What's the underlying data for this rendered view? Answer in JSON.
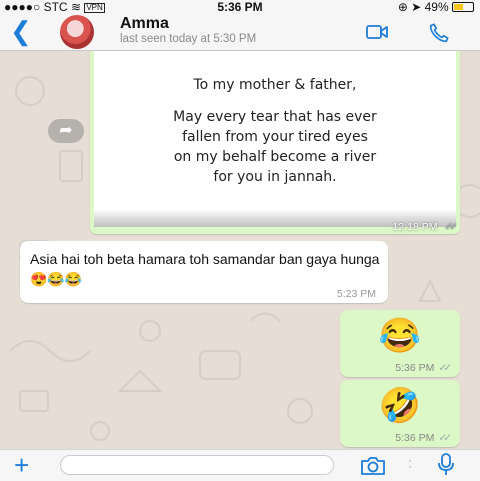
{
  "status_bar": {
    "signal": "●●●●○",
    "carrier": "STC",
    "wifi": "≋",
    "vpn": "VPN",
    "time": "5:36 PM",
    "location_icon": "➤",
    "battery_text": "49%",
    "battery_level": 0.49,
    "battery_color": "#f5c518"
  },
  "header": {
    "back_icon": "back-chevron-icon",
    "contact_name": "Amma",
    "last_seen": "last seen today at 5:30 PM",
    "accent_color": "#1d7dd8"
  },
  "messages": [
    {
      "type": "image",
      "direction": "outgoing",
      "image_text_title": "To my mother & father,",
      "image_text_lines": [
        "May every tear that has ever",
        "fallen from your tired eyes",
        "on my behalf become a river",
        "for you in jannah."
      ],
      "time": "12:18 PM"
    },
    {
      "type": "text",
      "direction": "incoming",
      "text": "Asia hai toh beta  hamara  toh samandar ban gaya hunga  😍😂😂",
      "time": "5:23 PM"
    },
    {
      "type": "emoji",
      "direction": "outgoing",
      "emoji": "😂",
      "time": "5:36 PM"
    },
    {
      "type": "emoji",
      "direction": "outgoing",
      "emoji": "🤣",
      "time": "5:36 PM"
    }
  ],
  "input_bar": {
    "plus_icon": "plus-icon",
    "placeholder": "",
    "camera_icon": "camera-icon",
    "mic_icon": "microphone-icon"
  },
  "colors": {
    "outgoing_bubble": "#dcf8c6",
    "incoming_bubble": "#ffffff",
    "chat_background": "#e6ded5"
  }
}
